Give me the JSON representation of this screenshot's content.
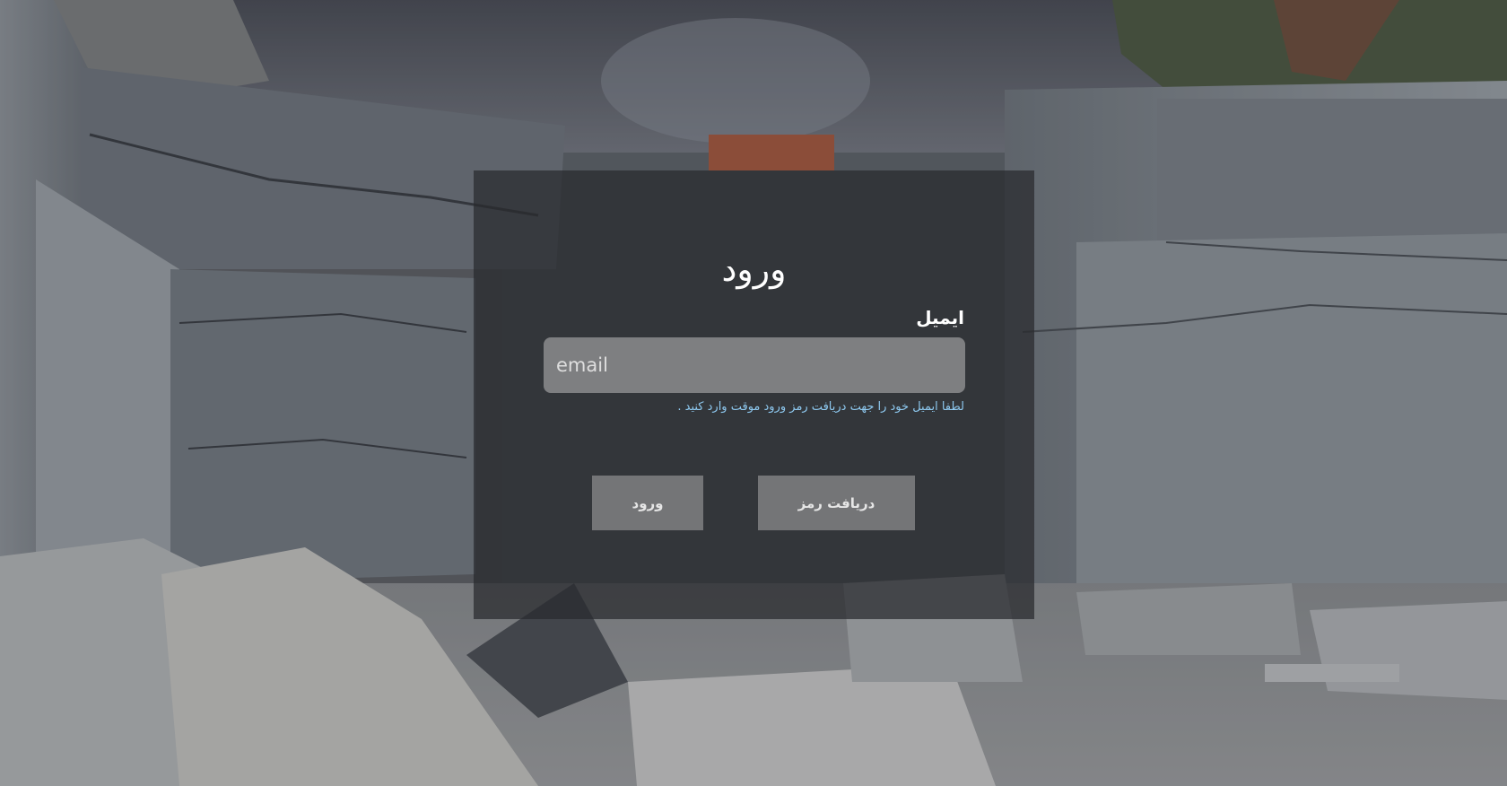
{
  "login": {
    "title": "ورود",
    "email_label": "ایمیل",
    "email_placeholder": "email",
    "email_value": "",
    "email_hint": "لطفا ایمیل خود را جهت دریافت رمز ورود موقت وارد کنید .",
    "get_code_button": "دریافت رمز",
    "login_button": "ورود"
  },
  "colors": {
    "panel_bg": "#2a2c30",
    "input_bg": "#8c8c8e",
    "button_bg": "#808082",
    "hint_text": "#8ec9f0",
    "title_text": "#ffffff"
  }
}
